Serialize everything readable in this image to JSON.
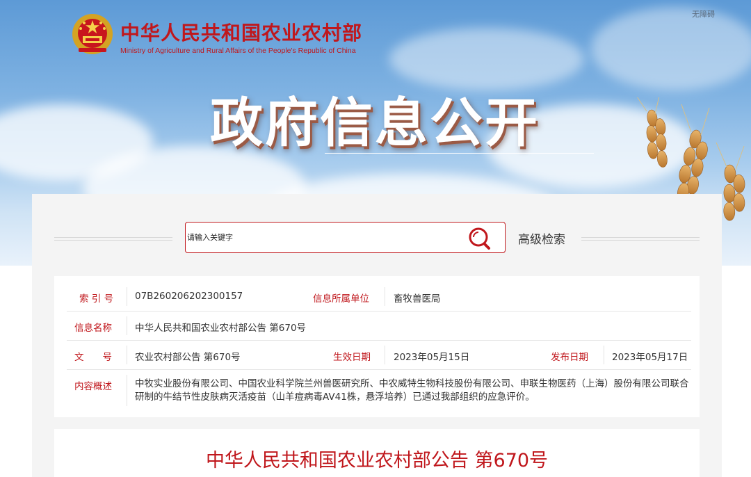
{
  "header": {
    "ministry_cn": "中华人民共和国农业农村部",
    "ministry_en": "Ministry of Agriculture and Rural Affairs of the People's Republic of China",
    "accessibility_link": "无障碍",
    "section_title": "政府信息公开",
    "brand_color": "#c0171c"
  },
  "search": {
    "placeholder": "请输入关键字",
    "search_icon": "search-icon",
    "advanced_label": "高级检索"
  },
  "meta": {
    "index_label": "索 引 号",
    "index_value": "07B260206202300157",
    "org_label": "信息所属单位",
    "org_value": "畜牧兽医局",
    "name_label": "信息名称",
    "name_value": "中华人民共和国农业农村部公告 第670号",
    "docno_label": "文　　号",
    "docno_value": "农业农村部公告 第670号",
    "effective_label": "生效日期",
    "effective_value": "2023年05月15日",
    "publish_label": "发布日期",
    "publish_value": "2023年05月17日",
    "summary_label": "内容概述",
    "summary_value": "中牧实业股份有限公司、中国农业科学院兰州兽医研究所、中农威特生物科技股份有限公司、申联生物医药（上海）股份有限公司联合研制的牛结节性皮肤病灭活疫苗（山羊痘病毒AV41株，悬浮培养）已通过我部组织的应急评价。"
  },
  "document": {
    "title": "中华人民共和国农业农村部公告 第670号"
  }
}
